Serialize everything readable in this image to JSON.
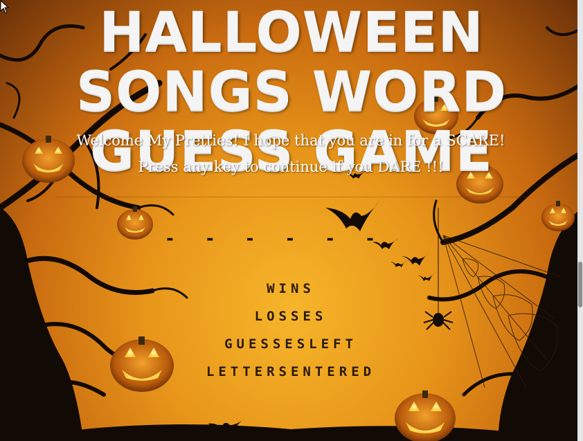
{
  "title": "HALLOWEEN SONGS WORD GUESS GAME",
  "welcome_message": "Welcome My Pretties! I hope that you are in for a SCARE! Press any key to continue if you DARE !!!",
  "word_blanks": [
    "-",
    "-",
    "-",
    "-",
    "-",
    "-"
  ],
  "stats": {
    "wins_label": "WINS",
    "losses_label": "LOSSES",
    "guesses_left_label": "GUESSESLEFT",
    "letters_entered_label": "LETTERSENTERED"
  },
  "colors": {
    "sky_center": "#f6b52a",
    "sky_edge": "#6a3008",
    "pumpkin": "#e07a12",
    "pumpkin_glow": "#ffe266",
    "silhouette": "#120a04",
    "title": "#f4f4f4"
  },
  "icons": [
    "mouse-cursor-icon",
    "jack-o-lantern-icon",
    "bat-icon",
    "spider-icon",
    "spider-web-icon",
    "tree-silhouette-icon"
  ]
}
